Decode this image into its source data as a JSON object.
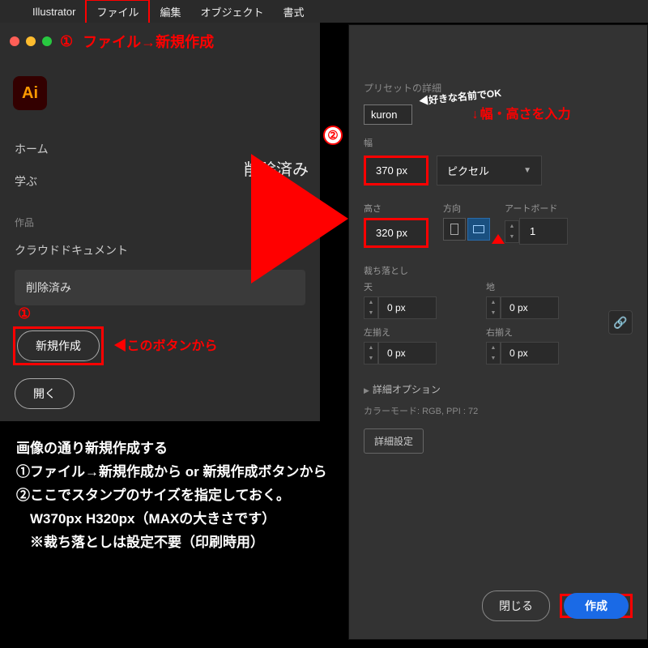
{
  "menubar": {
    "app": "Illustrator",
    "file": "ファイル",
    "edit": "編集",
    "object": "オブジェクト",
    "type": "書式"
  },
  "step1": {
    "num": "①",
    "label": "ファイル→新規作成"
  },
  "home": {
    "ai_logo": "Ai",
    "nav_home": "ホーム",
    "nav_learn": "学ぶ",
    "section_works": "作品",
    "nav_cloud": "クラウドドキュメント",
    "nav_deleted": "削除済み",
    "deleted_header": "削除済み",
    "num1": "①",
    "new_button": "新規作成",
    "new_note": "◀このボタンから",
    "open_button": "開く"
  },
  "newdoc": {
    "preset_label": "プリセットの詳細",
    "name_value": "kuron",
    "name_annot": "◀好きな名前でOK",
    "step2_num": "②",
    "step2_note": "幅・高さを入力",
    "width_label": "幅",
    "width_value": "370 px",
    "unit": "ピクセル",
    "height_label": "高さ",
    "height_value": "320 px",
    "orient_label": "方向",
    "artboard_label": "アートボード",
    "artboard_value": "1",
    "bleed_label": "裁ち落とし",
    "bleed_top": "天",
    "bleed_bottom": "地",
    "bleed_left": "左揃え",
    "bleed_right": "右揃え",
    "bleed_val": "0 px",
    "adv_toggle": "詳細オプション",
    "color_mode": "カラーモード: RGB, PPI : 72",
    "adv_button": "詳細設定",
    "close": "閉じる",
    "create": "作成"
  },
  "instructions": {
    "l1": "画像の通り新規作成する",
    "l2": "①ファイル→新規作成から or 新規作成ボタンから",
    "l3": "②ここでスタンプのサイズを指定しておく。",
    "l4": "　W370px H320px（MAXの大きさです）",
    "l5": "　※裁ち落としは設定不要（印刷時用）"
  }
}
